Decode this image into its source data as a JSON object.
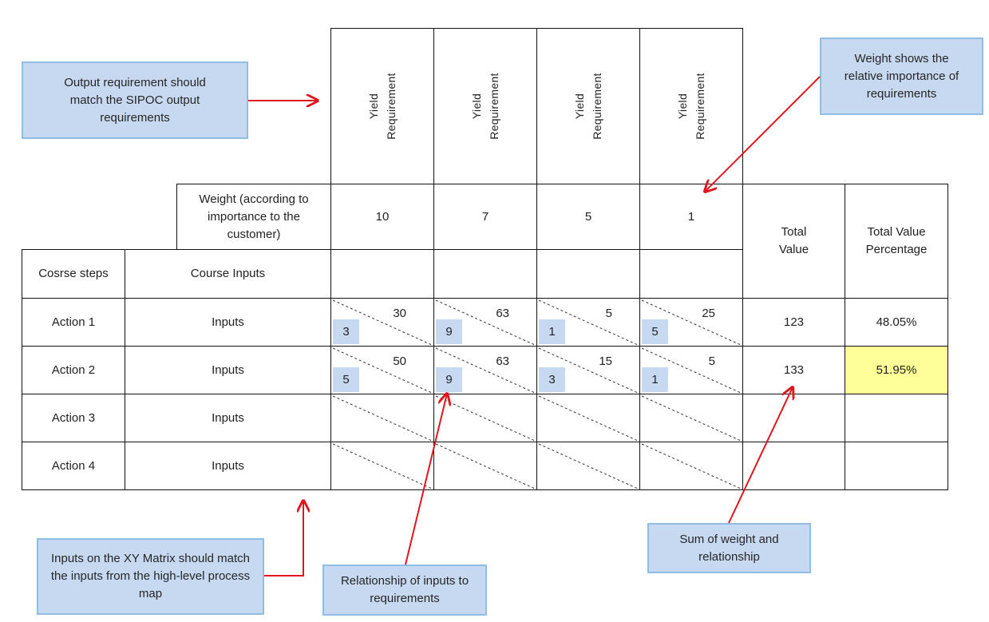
{
  "requirements": [
    {
      "label_line1": "Yield",
      "label_line2": "Requirement",
      "weight": "10"
    },
    {
      "label_line1": "Yield",
      "label_line2": "Requirement",
      "weight": "7"
    },
    {
      "label_line1": "Yield",
      "label_line2": "Requirement",
      "weight": "5"
    },
    {
      "label_line1": "Yield",
      "label_line2": "Requirement",
      "weight": "1"
    }
  ],
  "headers": {
    "weight_label": "Weight (according to importance to the customer)",
    "steps_label": "Cosrse steps",
    "inputs_label": "Course Inputs",
    "total_value": "Total Value",
    "total_value_pct": "Total Value Percentage"
  },
  "rows": [
    {
      "step": "Action 1",
      "input": "Inputs",
      "cells": [
        {
          "rel": "3",
          "score": "30"
        },
        {
          "rel": "9",
          "score": "63"
        },
        {
          "rel": "1",
          "score": "5"
        },
        {
          "rel": "5",
          "score": "25"
        }
      ],
      "total": "123",
      "pct": "48.05%",
      "highlight": false
    },
    {
      "step": "Action 2",
      "input": "Inputs",
      "cells": [
        {
          "rel": "5",
          "score": "50"
        },
        {
          "rel": "9",
          "score": "63"
        },
        {
          "rel": "3",
          "score": "15"
        },
        {
          "rel": "1",
          "score": "5"
        }
      ],
      "total": "133",
      "pct": "51.95%",
      "highlight": true
    },
    {
      "step": "Action 3",
      "input": "Inputs",
      "cells": [
        {
          "rel": "",
          "score": ""
        },
        {
          "rel": "",
          "score": ""
        },
        {
          "rel": "",
          "score": ""
        },
        {
          "rel": "",
          "score": ""
        }
      ],
      "total": "",
      "pct": "",
      "highlight": false
    },
    {
      "step": "Action 4",
      "input": "Inputs",
      "cells": [
        {
          "rel": "",
          "score": ""
        },
        {
          "rel": "",
          "score": ""
        },
        {
          "rel": "",
          "score": ""
        },
        {
          "rel": "",
          "score": ""
        }
      ],
      "total": "",
      "pct": "",
      "highlight": false
    }
  ],
  "callouts": {
    "output_requirement": "Output requirement should match the SIPOC output requirements",
    "weight": "Weight shows the relative importance of requirements",
    "inputs": "Inputs on the XY Matrix should match the inputs from the high-level process map",
    "relationship": "Relationship of inputs to requirements",
    "sum": "Sum of weight and relationship"
  },
  "colors": {
    "callout_fill": "#c6d9f0",
    "callout_border": "#8fbde6",
    "arrow": "#e0161e",
    "highlight": "#ffff99",
    "rel_box": "#c6d9f0"
  }
}
